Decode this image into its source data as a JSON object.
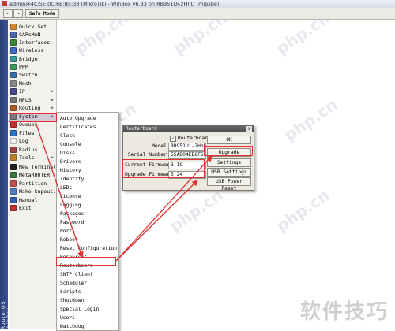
{
  "window": {
    "title": "admin@4C:5E:0C:6E:B5:38 (MikroTik) - WinBox v6.33 on RB951Ui-2HnD (mipsbe)"
  },
  "toolbar": {
    "safe_mode_label": "Safe Mode"
  },
  "sidebar": {
    "vertical_label": "RouterOS WinBox",
    "items": [
      {
        "label": "Quick Set",
        "icon": "quick-set-icon",
        "color": "#d28b2c",
        "has_arrow": false
      },
      {
        "label": "CAPsMAN",
        "icon": "capsman-icon",
        "color": "#4a6bb0",
        "has_arrow": false
      },
      {
        "label": "Interfaces",
        "icon": "interfaces-icon",
        "color": "#3b8a3b",
        "has_arrow": false
      },
      {
        "label": "Wireless",
        "icon": "wireless-icon",
        "color": "#3b6cc8",
        "has_arrow": false
      },
      {
        "label": "Bridge",
        "icon": "bridge-icon",
        "color": "#3a9a9a",
        "has_arrow": false
      },
      {
        "label": "PPP",
        "icon": "ppp-icon",
        "color": "#3a9a5a",
        "has_arrow": false
      },
      {
        "label": "Switch",
        "icon": "switch-icon",
        "color": "#3a70b0",
        "has_arrow": false
      },
      {
        "label": "Mesh",
        "icon": "mesh-icon",
        "color": "#888888",
        "has_arrow": false
      },
      {
        "label": "IP",
        "icon": "ip-icon",
        "color": "#4a4a8a",
        "has_arrow": true
      },
      {
        "label": "MPLS",
        "icon": "mpls-icon",
        "color": "#777777",
        "has_arrow": true
      },
      {
        "label": "Routing",
        "icon": "routing-icon",
        "color": "#b05a2a",
        "has_arrow": true
      },
      {
        "label": "System",
        "icon": "system-icon",
        "color": "#7a7a7a",
        "has_arrow": true
      },
      {
        "label": "Queues",
        "icon": "queues-icon",
        "color": "#c03030",
        "has_arrow": false
      },
      {
        "label": "Files",
        "icon": "files-icon",
        "color": "#3070c0",
        "has_arrow": false
      },
      {
        "label": "Log",
        "icon": "log-icon",
        "color": "#eeeeee",
        "has_arrow": false
      },
      {
        "label": "Radius",
        "icon": "radius-icon",
        "color": "#a04040",
        "has_arrow": false
      },
      {
        "label": "Tools",
        "icon": "tools-icon",
        "color": "#c08030",
        "has_arrow": true
      },
      {
        "label": "New Terminal",
        "icon": "terminal-icon",
        "color": "#222222",
        "has_arrow": false
      },
      {
        "label": "MetaROUTER",
        "icon": "metarouter-icon",
        "color": "#3a7a3a",
        "has_arrow": false
      },
      {
        "label": "Partition",
        "icon": "partition-icon",
        "color": "#c05050",
        "has_arrow": false
      },
      {
        "label": "Make Supout.rif",
        "icon": "supout-icon",
        "color": "#5080c0",
        "has_arrow": false
      },
      {
        "label": "Manual",
        "icon": "manual-icon",
        "color": "#3060b0",
        "has_arrow": false
      },
      {
        "label": "Exit",
        "icon": "exit-icon",
        "color": "#c03030",
        "has_arrow": false
      }
    ]
  },
  "system_menu": {
    "items": [
      "Auto Upgrade",
      "Certificates",
      "Clock",
      "Console",
      "Disks",
      "Drivers",
      "History",
      "Identity",
      "LEDs",
      "License",
      "Logging",
      "Packages",
      "Password",
      "Ports",
      "Reboot",
      "Reset Configuration",
      "Resources",
      "Routerboard",
      "SNTP Client",
      "Scheduler",
      "Scripts",
      "Shutdown",
      "Special Login",
      "Users",
      "Watchdog"
    ]
  },
  "dialog": {
    "title": "Routerboard",
    "close_glyph": "x",
    "routerboard_checkbox_label": "Routerboard",
    "routerboard_checked": true,
    "model_label": "Model",
    "model_value": "RB951Ui-2HnD",
    "serial_label": "Serial Number",
    "serial_value": "55AD04EB8F53",
    "current_fw_label": "Current Firmware",
    "current_fw_value": "3.19",
    "upgrade_fw_label": "Upgrade Firmware",
    "upgrade_fw_value": "3.24",
    "buttons": {
      "ok": "OK",
      "upgrade": "Upgrade",
      "settings": "Settings",
      "usb_settings": "USB Settings",
      "usb_power_reset": "USB Power Reset"
    }
  },
  "watermark": {
    "site": "php.cn",
    "corner": "软件技巧"
  },
  "colors": {
    "highlight": "#e03030",
    "sidebar_selected": "#cfcad8",
    "left_strip": "#2a3e78"
  }
}
